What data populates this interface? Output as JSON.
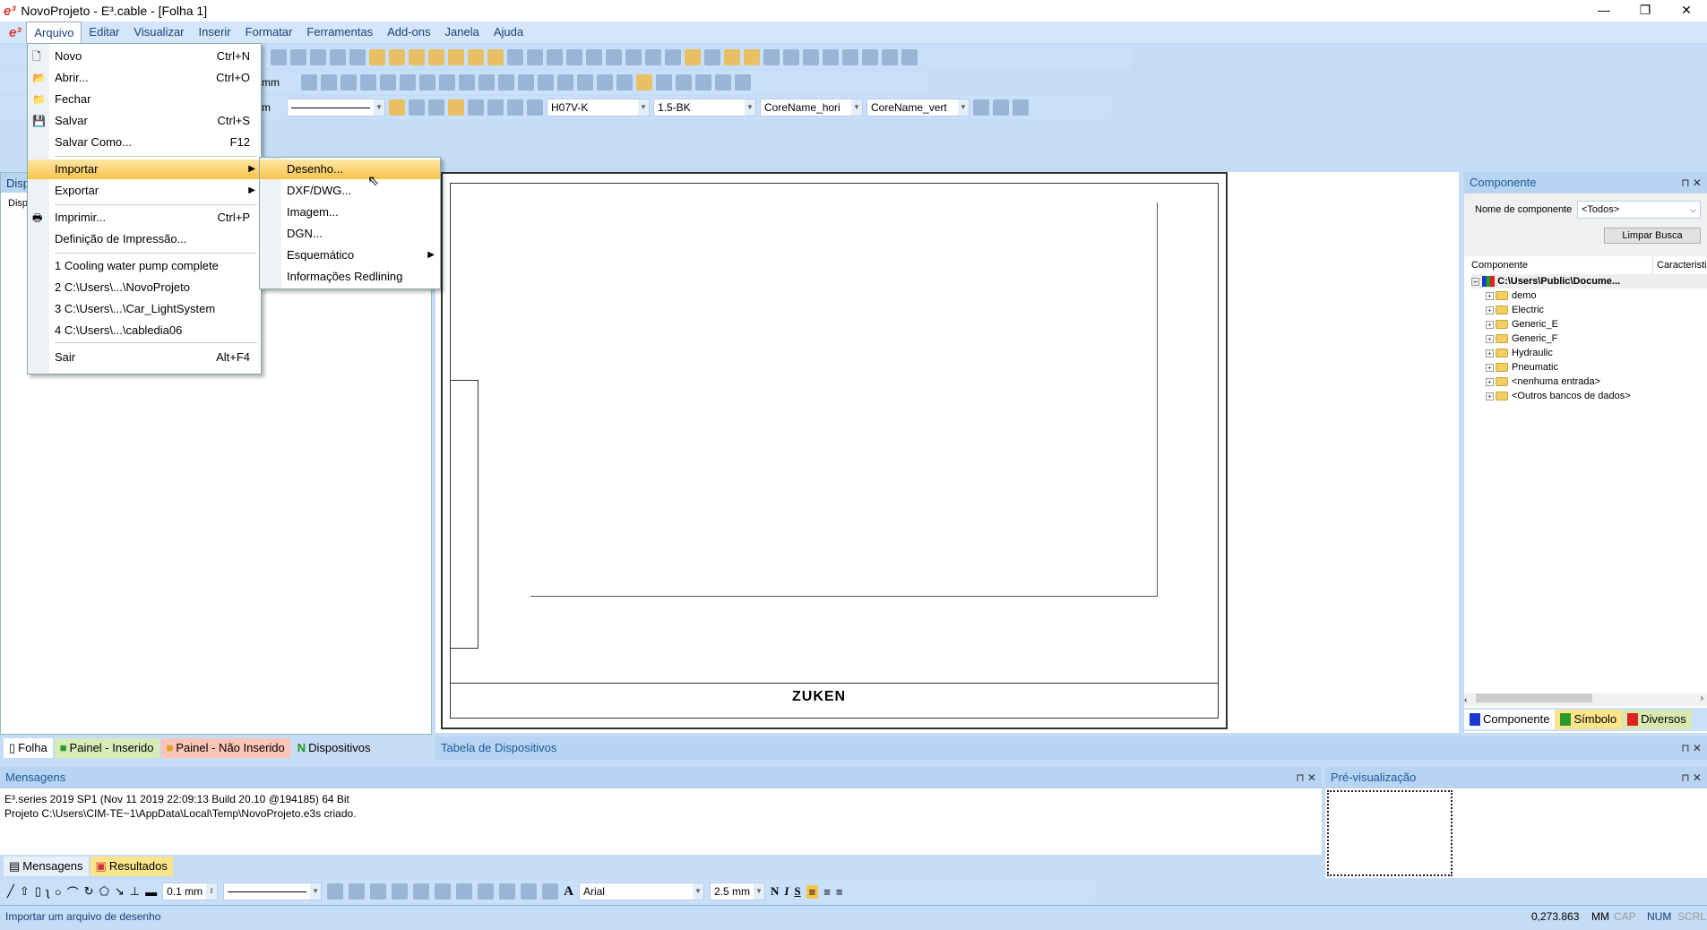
{
  "window": {
    "title": "NovoProjeto - E³.cable - [Folha 1]",
    "controls": [
      "—",
      "❐",
      "✕"
    ]
  },
  "menubar": {
    "items": [
      "Arquivo",
      "Editar",
      "Visualizar",
      "Inserir",
      "Formatar",
      "Ferramentas",
      "Add-ons",
      "Janela",
      "Ajuda"
    ]
  },
  "file_menu": {
    "items": [
      {
        "label": "Novo",
        "shortcut": "Ctrl+N",
        "icon": "new-file-icon"
      },
      {
        "label": "Abrir...",
        "shortcut": "Ctrl+O",
        "icon": "open-folder-icon"
      },
      {
        "label": "Fechar",
        "shortcut": "",
        "icon": "close-folder-icon"
      },
      {
        "label": "Salvar",
        "shortcut": "Ctrl+S",
        "icon": "save-icon"
      },
      {
        "label": "Salvar Como...",
        "shortcut": "F12"
      },
      {
        "label": "Importar",
        "submenu": true
      },
      {
        "label": "Exportar",
        "submenu": true
      },
      {
        "label": "Imprimir...",
        "shortcut": "Ctrl+P",
        "icon": "printer-icon"
      },
      {
        "label": "Definição de Impressão..."
      },
      {
        "label": "1 Cooling water pump complete"
      },
      {
        "label": "2 C:\\Users\\...\\NovoProjeto"
      },
      {
        "label": "3 C:\\Users\\...\\Car_LightSystem"
      },
      {
        "label": "4 C:\\Users\\...\\cabledia06"
      },
      {
        "label": "Sair",
        "shortcut": "Alt+F4"
      }
    ]
  },
  "import_submenu": {
    "items": [
      "Desenho...",
      "DXF/DWG...",
      "Imagem...",
      "DGN...",
      "Esquemático",
      "Informações Redlining"
    ]
  },
  "toolbar": {
    "row2_unit": "mm",
    "row3_unit": "m",
    "cable_type": "H07V-K",
    "core": "1.5-BK",
    "core_name_h": "CoreName_hori",
    "core_name_v": "CoreName_vert"
  },
  "left_panel": {
    "title": "Disp",
    "tree_root": "Disp"
  },
  "left_tabs": [
    "Folha",
    "Painel - Inserido",
    "Painel - Não Inserido",
    "Dispositivos"
  ],
  "device_table": {
    "title": "Tabela de Dispositivos"
  },
  "drawing": {
    "logo": "ZUKEN"
  },
  "component_panel": {
    "title": "Componente",
    "filter_label": "Nome de componente",
    "filter_value": "<Todos>",
    "clear_button": "Limpar Busca",
    "col1": "Componente",
    "col2": "Caracteristi",
    "root": "C:\\Users\\Public\\Docume...",
    "folders": [
      "demo",
      "Electric",
      "Generic_E",
      "Generic_F",
      "Hydraulic",
      "Pneumatic",
      "<nenhuma entrada>",
      "<Outros bancos de dados>"
    ]
  },
  "right_tabs": [
    "Componente",
    "Símbolo",
    "Diversos"
  ],
  "messages": {
    "title": "Mensagens",
    "lines": [
      "E³.series 2019 SP1 (Nov 11 2019 22:09:13 Build 20.10 @194185) 64 Bit",
      "Projeto C:\\Users\\CIM-TE~1\\AppData\\Local\\Temp\\NovoProjeto.e3s criado."
    ]
  },
  "message_tabs": [
    "Mensagens",
    "Resultados"
  ],
  "preview": {
    "title": "Pré-visualização"
  },
  "draw_toolbar": {
    "line_width": "0.1 mm",
    "font": "Arial",
    "font_size": "2.5 mm",
    "bold": "N",
    "italic": "I",
    "strike": "S"
  },
  "statusbar": {
    "text": "Importar um arquivo de desenho",
    "coords": "0,273.863",
    "unit": "MM",
    "cap": "CAP",
    "num": "NUM",
    "scrl": "SCRL"
  }
}
